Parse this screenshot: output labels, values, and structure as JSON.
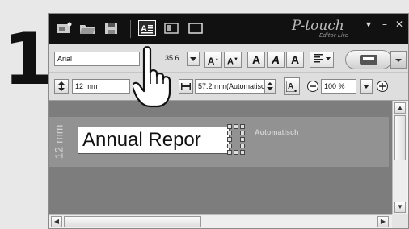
{
  "step": {
    "number": "1"
  },
  "titlebar": {
    "logo": "P-touch",
    "logo_sub": "Editor Lite",
    "buttons": [
      "new-label",
      "open-file",
      "save-file",
      "text-mode",
      "layout-mode",
      "frame-mode"
    ],
    "win_controls": {
      "menu": "▾",
      "minimize": "–",
      "close": "✕"
    }
  },
  "toolbar": {
    "font": "Arial",
    "font_size": "35.6",
    "tape_width": "12 mm",
    "label_length": "57.2 mm(Automatisc",
    "zoom": "100 %",
    "zoom_out": "−",
    "zoom_in": "+",
    "format_buttons": {
      "grow": "A",
      "shrink": "A",
      "bold": "A",
      "italic": "A",
      "underline": "A"
    }
  },
  "canvas": {
    "tape_label": "12 mm",
    "text": "Annual Repor",
    "auto_label": "Automatisch"
  },
  "colors": {
    "titlebar": "#111111",
    "canvas": "#7d7d7d",
    "label_tape": "#929292"
  }
}
